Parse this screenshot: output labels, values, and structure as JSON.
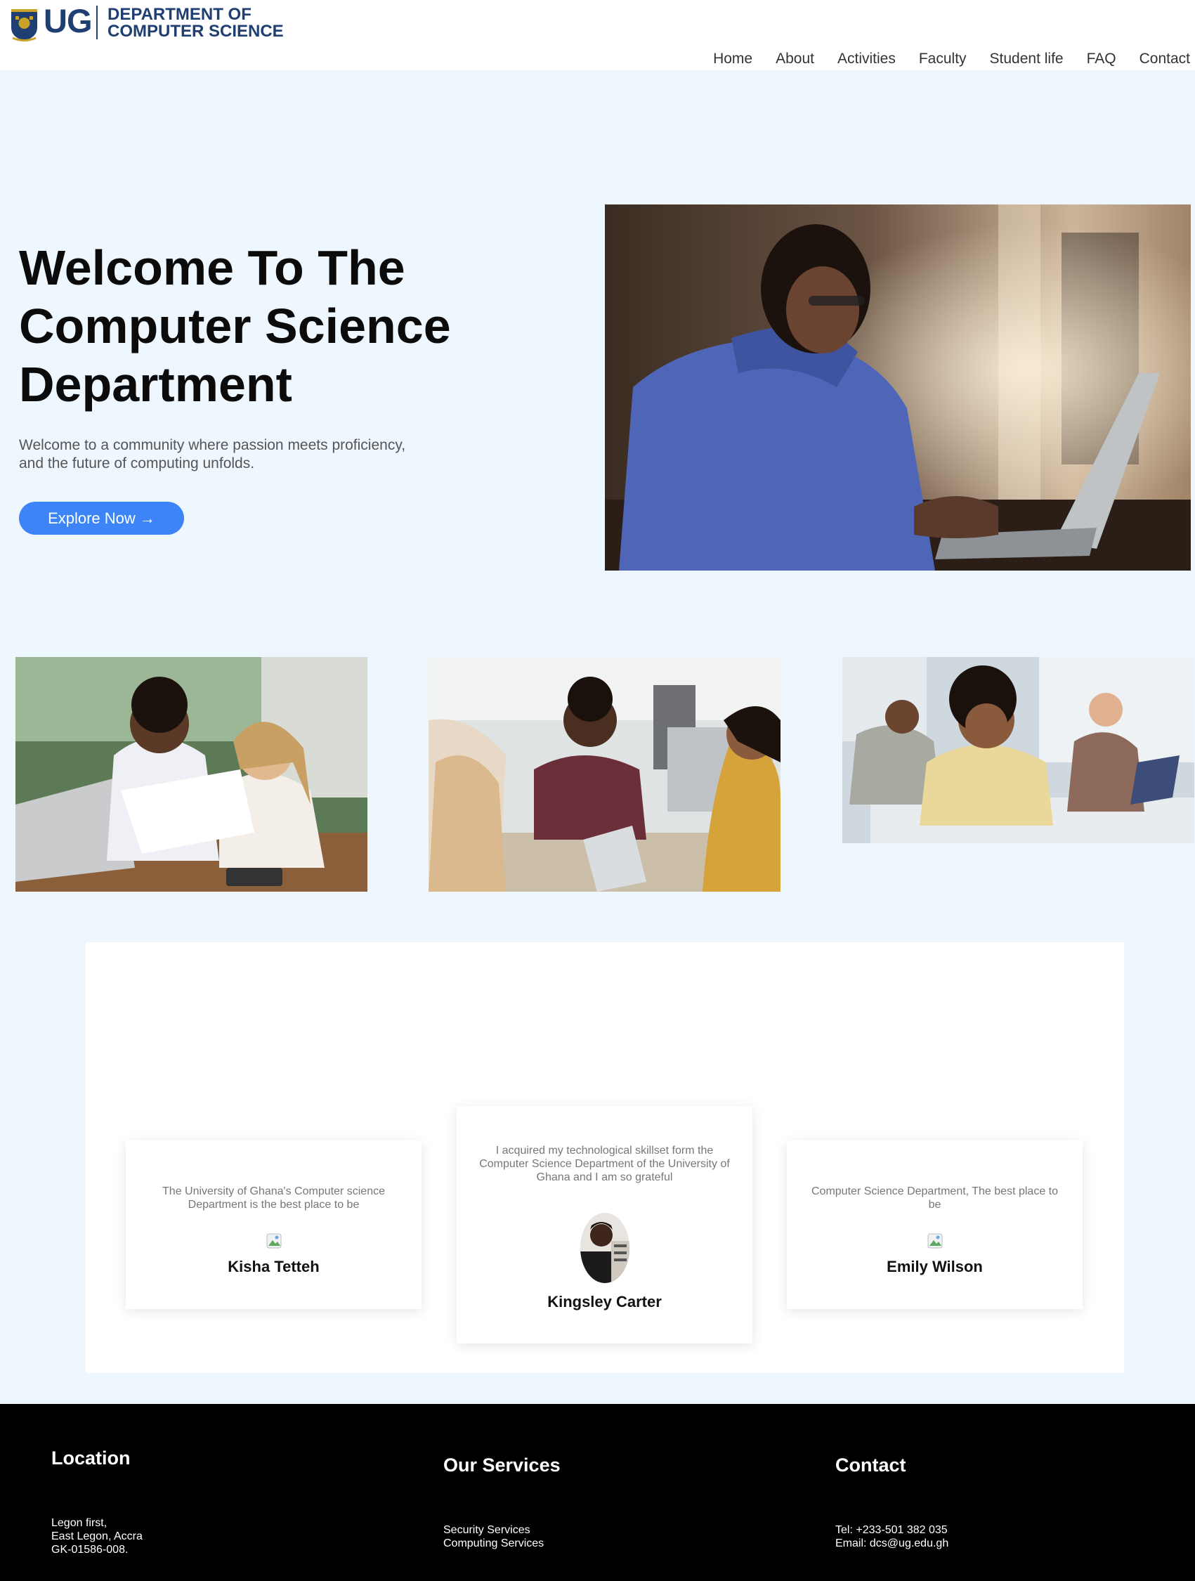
{
  "brand": {
    "logo_text": "UG",
    "dept_line1": "DEPARTMENT OF",
    "dept_line2": "COMPUTER SCIENCE",
    "color": "#1f3f73"
  },
  "nav": {
    "items": [
      "Home",
      "About",
      "Activities",
      "Faculty",
      "Student life",
      "FAQ",
      "Contact"
    ]
  },
  "hero": {
    "title_line1": "Welcome To The",
    "title_line2": "Computer Science",
    "title_line3": "Department",
    "subtitle_line1": "Welcome to a community where passion meets proficiency,",
    "subtitle_line2": "and the future of computing unfolds.",
    "button_label": "Explore Now →",
    "accent": "#3d85f7"
  },
  "testimonials": [
    {
      "quote": "The University of Ghana's Computer science Department is the best place to be",
      "name": "Kisha Tetteh"
    },
    {
      "quote": "I acquired my technological skillset form the Computer Science Department of the University of Ghana and I am so grateful",
      "name": "Kingsley Carter"
    },
    {
      "quote": "Computer Science Department, The best place to be",
      "name": "Emily Wilson"
    }
  ],
  "footer": {
    "location": {
      "heading": "Location",
      "line1": "Legon first,",
      "line2": "East Legon, Accra",
      "line3": "GK-01586-008."
    },
    "services": {
      "heading": "Our Services",
      "line1": "Security Services",
      "line2": "Computing Services"
    },
    "contact": {
      "heading": "Contact",
      "line1": "Tel: +233-501 382 035",
      "line2": "Email: dcs@ug.edu.gh"
    }
  }
}
